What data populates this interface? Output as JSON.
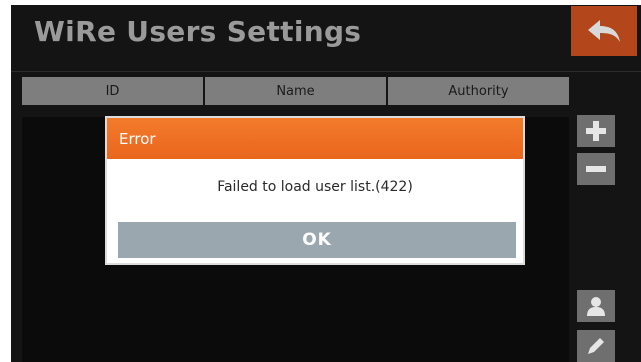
{
  "header": {
    "title": "WiRe Users Settings",
    "back_icon": "back-arrow-icon"
  },
  "table": {
    "columns": [
      "ID",
      "Name",
      "Authority"
    ]
  },
  "side_buttons": [
    "plus-icon",
    "minus-icon",
    "user-icon",
    "pencil-icon"
  ],
  "dialog": {
    "title": "Error",
    "message": "Failed to load user list.(422)",
    "ok_label": "OK"
  },
  "colors": {
    "accent": "#ee6f25",
    "back_button": "#b4461c",
    "ok_button": "#9aa7ae"
  }
}
